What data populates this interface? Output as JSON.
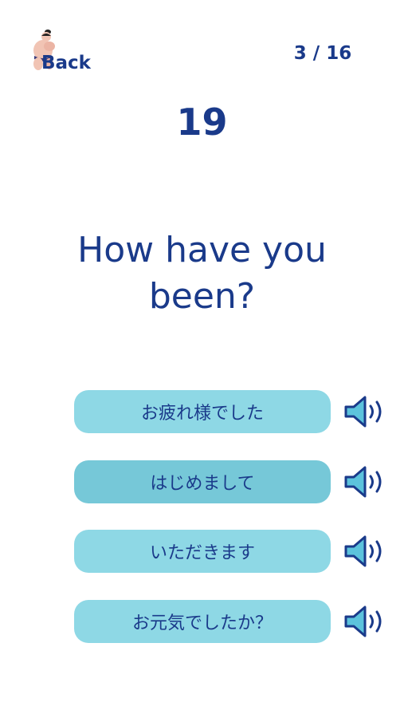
{
  "header": {
    "back_label": "Back",
    "progress": "3 / 16"
  },
  "question": {
    "number": "19",
    "text": "How have you been?"
  },
  "options": [
    {
      "label": "お疲れ様でした",
      "audio_icon": "speaker-icon"
    },
    {
      "label": "はじめまして",
      "audio_icon": "speaker-icon"
    },
    {
      "label": "いただきます",
      "audio_icon": "speaker-icon"
    },
    {
      "label": "お元気でしたか？",
      "audio_icon": "speaker-icon"
    }
  ],
  "colors": {
    "text": "#1a3a8a",
    "option_bg": "#8ed8e5",
    "option_bg_selected": "#76c8d8"
  }
}
